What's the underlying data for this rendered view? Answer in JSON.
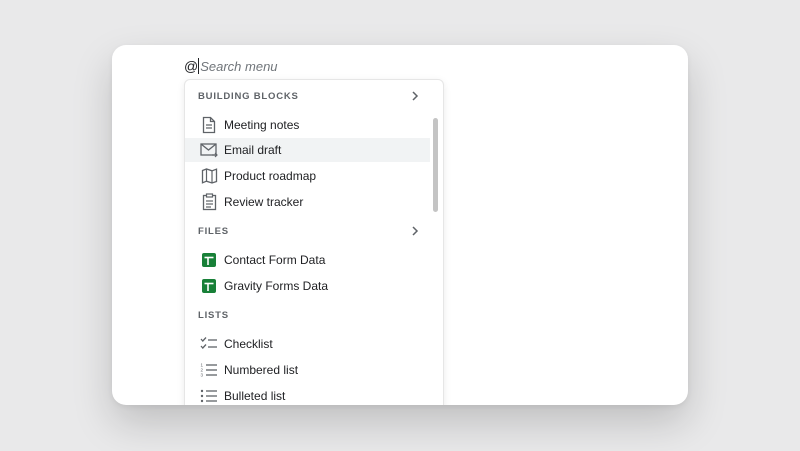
{
  "search": {
    "prefix": "@",
    "placeholder": "Search menu"
  },
  "sections": {
    "building_blocks": {
      "title": "BUILDING BLOCKS",
      "items": [
        {
          "label": "Meeting notes",
          "icon": "document-icon"
        },
        {
          "label": "Email draft",
          "icon": "email-icon"
        },
        {
          "label": "Product roadmap",
          "icon": "map-icon"
        },
        {
          "label": "Review tracker",
          "icon": "clipboard-icon"
        }
      ]
    },
    "files": {
      "title": "FILES",
      "items": [
        {
          "label": "Contact Form Data",
          "icon": "sheets-icon"
        },
        {
          "label": "Gravity Forms Data",
          "icon": "sheets-icon"
        }
      ]
    },
    "lists": {
      "title": "LISTS",
      "items": [
        {
          "label": "Checklist",
          "icon": "checklist-icon"
        },
        {
          "label": "Numbered list",
          "icon": "numbered-list-icon"
        },
        {
          "label": "Bulleted list",
          "icon": "bulleted-list-icon"
        }
      ]
    }
  },
  "colors": {
    "sheets_green": "#188038",
    "highlight": "#f1f3f4",
    "icon_gray": "#5f6368"
  }
}
